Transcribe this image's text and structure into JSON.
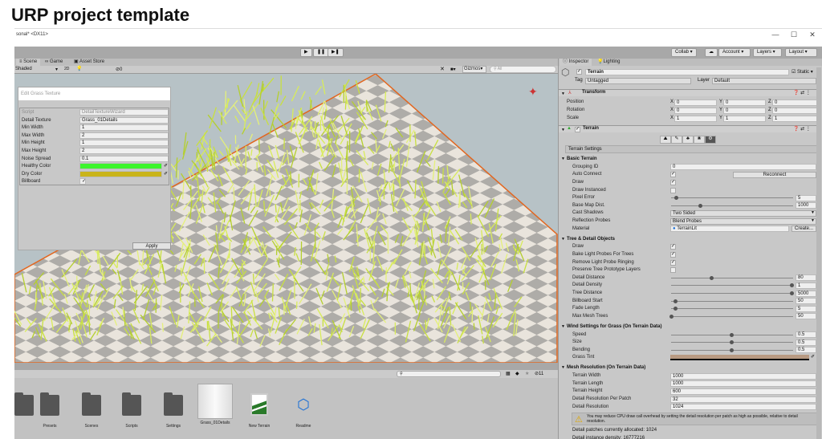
{
  "page_title": "URP project template",
  "window": {
    "title": "sonal* <DX11>",
    "controls": [
      "—",
      "☐",
      "✕"
    ]
  },
  "toolbar": {
    "play": "▶",
    "pause": "❚❚",
    "step": "▶❚",
    "collab": "Collab ▾",
    "cloud": "☁",
    "account": "Account ▾",
    "layers": "Layers ▾",
    "layout": "Layout ▾"
  },
  "scene_tabs": [
    "Scene",
    "Game",
    "Asset Store"
  ],
  "scene_toolbar": {
    "shading": "Shaded",
    "mode_2d": "2D",
    "hidden_count": "0",
    "gizmos": "Gizmos",
    "search_placeholder": "All"
  },
  "grass_window": {
    "title": "Edit Grass Texture",
    "rows": [
      {
        "label": "Script",
        "value": "DetailTextureWizard"
      },
      {
        "label": "Detail Texture",
        "value": "Grass_01Details"
      },
      {
        "label": "Min Width",
        "value": "1"
      },
      {
        "label": "Max Width",
        "value": "2"
      },
      {
        "label": "Min Height",
        "value": "1"
      },
      {
        "label": "Max Height",
        "value": "2"
      },
      {
        "label": "Noise Spread",
        "value": "0.1"
      },
      {
        "label": "Healthy Color",
        "value": ""
      },
      {
        "label": "Dry Color",
        "value": ""
      },
      {
        "label": "Billboard",
        "value": "✓"
      }
    ],
    "healthy_color": "#3cf52c",
    "dry_color": "#c9b41a",
    "apply": "Apply"
  },
  "project": {
    "search_placeholder": "",
    "hidden_count": "11",
    "assets": [
      "",
      "Presets",
      "Scenes",
      "Scripts",
      "Settings",
      "Grass_01Details",
      "New Terrain",
      "Readme"
    ]
  },
  "inspector": {
    "tabs": [
      "Inspector",
      "Lighting"
    ],
    "object_name": "Terrain",
    "static_label": "Static ▾",
    "tag_label": "Tag",
    "tag": "Untagged",
    "layer_label": "Layer",
    "layer": "Default",
    "transform": {
      "title": "Transform",
      "rows": [
        {
          "label": "Position",
          "x": "0",
          "y": "0",
          "z": "0"
        },
        {
          "label": "Rotation",
          "x": "0",
          "y": "0",
          "z": "0"
        },
        {
          "label": "Scale",
          "x": "1",
          "y": "1",
          "z": "1"
        }
      ]
    },
    "terrain_title": "Terrain",
    "terrain_settings": "Terrain Settings",
    "sections": [
      {
        "title": "Basic Terrain",
        "rows": [
          {
            "label": "Grouping ID",
            "type": "field",
            "value": "0"
          },
          {
            "label": "Auto Connect",
            "type": "check",
            "value": "✓",
            "button": "Reconnect"
          },
          {
            "label": "Draw",
            "type": "check",
            "value": "✓"
          },
          {
            "label": "Draw Instanced",
            "type": "check",
            "value": ""
          },
          {
            "label": "Pixel Error",
            "type": "slider",
            "value": "5",
            "fraction": 0.04
          },
          {
            "label": "Base Map Dist.",
            "type": "slider",
            "value": "1000",
            "fraction": 0.24
          },
          {
            "label": "Cast Shadows",
            "type": "dropdown",
            "value": "Two Sided"
          },
          {
            "label": "Reflection Probes",
            "type": "dropdown",
            "value": "Blend Probes"
          },
          {
            "label": "Material",
            "type": "object",
            "value": "TerrainLit",
            "button": "Create..."
          }
        ]
      },
      {
        "title": "Tree & Detail Objects",
        "rows": [
          {
            "label": "Draw",
            "type": "check",
            "value": "✓"
          },
          {
            "label": "Bake Light Probes For Trees",
            "type": "check",
            "value": "✓"
          },
          {
            "label": "Remove Light Probe Ringing",
            "type": "check",
            "value": "✓"
          },
          {
            "label": "Preserve Tree Prototype Layers",
            "type": "check",
            "value": ""
          },
          {
            "label": "Detail Distance",
            "type": "slider",
            "value": "80",
            "fraction": 0.33
          },
          {
            "label": "Detail Density",
            "type": "slider",
            "value": "1",
            "fraction": 1.0
          },
          {
            "label": "Tree Distance",
            "type": "slider",
            "value": "5000",
            "fraction": 1.0
          },
          {
            "label": "Billboard Start",
            "type": "slider",
            "value": "50",
            "fraction": 0.03
          },
          {
            "label": "Fade Length",
            "type": "slider",
            "value": "5",
            "fraction": 0.03
          },
          {
            "label": "Max Mesh Trees",
            "type": "slider",
            "value": "50",
            "fraction": 0.0
          }
        ]
      },
      {
        "title": "Wind Settings for Grass (On Terrain Data)",
        "rows": [
          {
            "label": "Speed",
            "type": "slider",
            "value": "0.5",
            "fraction": 0.5
          },
          {
            "label": "Size",
            "type": "slider",
            "value": "0.5",
            "fraction": 0.5
          },
          {
            "label": "Bending",
            "type": "slider",
            "value": "0.5",
            "fraction": 0.5
          },
          {
            "label": "Grass Tint",
            "type": "color",
            "value": "#b89a82"
          }
        ]
      },
      {
        "title": "Mesh Resolution (On Terrain Data)",
        "rows": [
          {
            "label": "Terrain Width",
            "type": "field",
            "value": "1000"
          },
          {
            "label": "Terrain Length",
            "type": "field",
            "value": "1000"
          },
          {
            "label": "Terrain Height",
            "type": "field",
            "value": "600"
          },
          {
            "label": "Detail Resolution Per Patch",
            "type": "field",
            "value": "32"
          },
          {
            "label": "Detail Resolution",
            "type": "field",
            "value": "1024"
          }
        ]
      }
    ],
    "warning": "You may reduce CPU draw call overhead by setting the detail resolution per patch as high as possible, relative to detail resolution.",
    "patches": "Detail patches currently allocated: 1024",
    "density": "Detail instance density: 16777216"
  }
}
